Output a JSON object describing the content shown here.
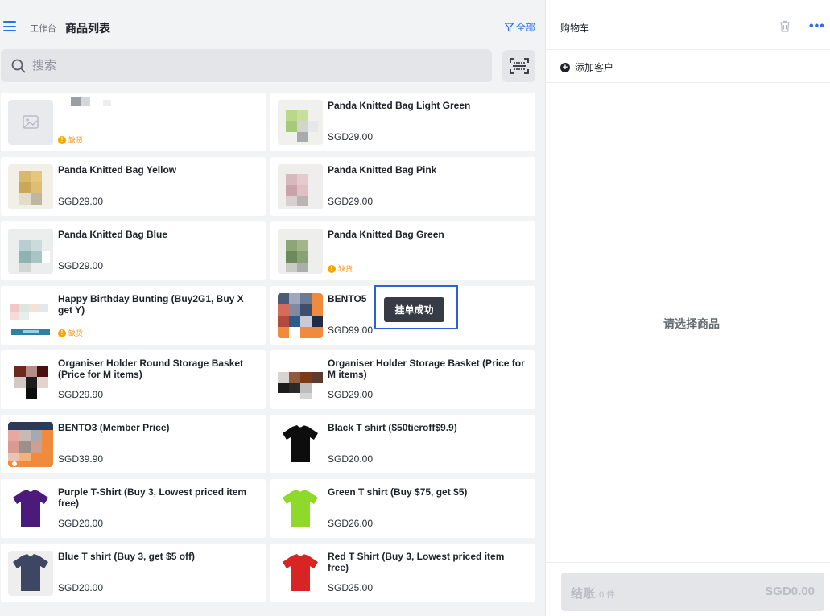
{
  "header": {
    "breadcrumb": "工作台",
    "title": "商品列表",
    "filter_label": "全部"
  },
  "search": {
    "placeholder": "搜索"
  },
  "products": [
    {
      "name": "",
      "price": "",
      "stock": "缺货",
      "thumb": "placeholder"
    },
    {
      "name": "Panda Knitted Bag Light Green",
      "price": "SGD29.00",
      "stock": "",
      "thumb": "bag-light-green"
    },
    {
      "name": "Panda Knitted Bag Yellow",
      "price": "SGD29.00",
      "stock": "",
      "thumb": "bag-yellow"
    },
    {
      "name": "Panda Knitted Bag Pink",
      "price": "SGD29.00",
      "stock": "",
      "thumb": "bag-pink"
    },
    {
      "name": "Panda Knitted Bag Blue",
      "price": "SGD29.00",
      "stock": "",
      "thumb": "bag-blue"
    },
    {
      "name": "Panda Knitted Bag Green",
      "price": "",
      "stock": "缺货",
      "thumb": "bag-green"
    },
    {
      "name": "Happy Birthday Bunting (Buy2G1, Buy X get Y)",
      "price": "",
      "stock": "缺货",
      "thumb": "bunting"
    },
    {
      "name": "BENTO5",
      "price": "SGD99.00",
      "stock": "",
      "thumb": "bento"
    },
    {
      "name": "Organiser Holder Round Storage Basket (Price for M items)",
      "price": "SGD29.90",
      "stock": "",
      "thumb": "basket-round"
    },
    {
      "name": "Organiser Holder Storage Basket (Price for M items)",
      "price": "SGD29.00",
      "stock": "",
      "thumb": "basket"
    },
    {
      "name": "BENTO3 (Member Price)",
      "price": "SGD39.90",
      "stock": "",
      "thumb": "bento3"
    },
    {
      "name": "Black T shirt ($50tieroff$9.9)",
      "price": "SGD20.00",
      "stock": "",
      "thumb": "tshirt-black"
    },
    {
      "name": "Purple T-Shirt (Buy 3, Lowest priced item free)",
      "price": "SGD20.00",
      "stock": "",
      "thumb": "tshirt-purple"
    },
    {
      "name": "Green T shirt (Buy $75, get $5)",
      "price": "SGD26.00",
      "stock": "",
      "thumb": "tshirt-green"
    },
    {
      "name": "Blue T shirt (Buy 3, get $5 off)",
      "price": "SGD20.00",
      "stock": "",
      "thumb": "tshirt-navy"
    },
    {
      "name": "Red T Shirt (Buy 3, Lowest priced item free)",
      "price": "SGD25.00",
      "stock": "",
      "thumb": "tshirt-red"
    }
  ],
  "toast": {
    "message": "挂单成功"
  },
  "cart": {
    "title": "购物车",
    "add_customer": "添加客户",
    "empty_message": "请选择商品",
    "checkout_label": "结账",
    "item_count": "0 件",
    "total": "SGD0.00"
  },
  "colors": {
    "accent": "#2f6fe4",
    "warning": "#f7a500",
    "toast_bg": "#363b45"
  },
  "icons": {
    "menu": "menu-icon",
    "filter": "filter-icon",
    "search": "search-icon",
    "scan": "scan-icon",
    "trash": "trash-icon",
    "more": "more-icon",
    "add": "add-circle-icon"
  }
}
